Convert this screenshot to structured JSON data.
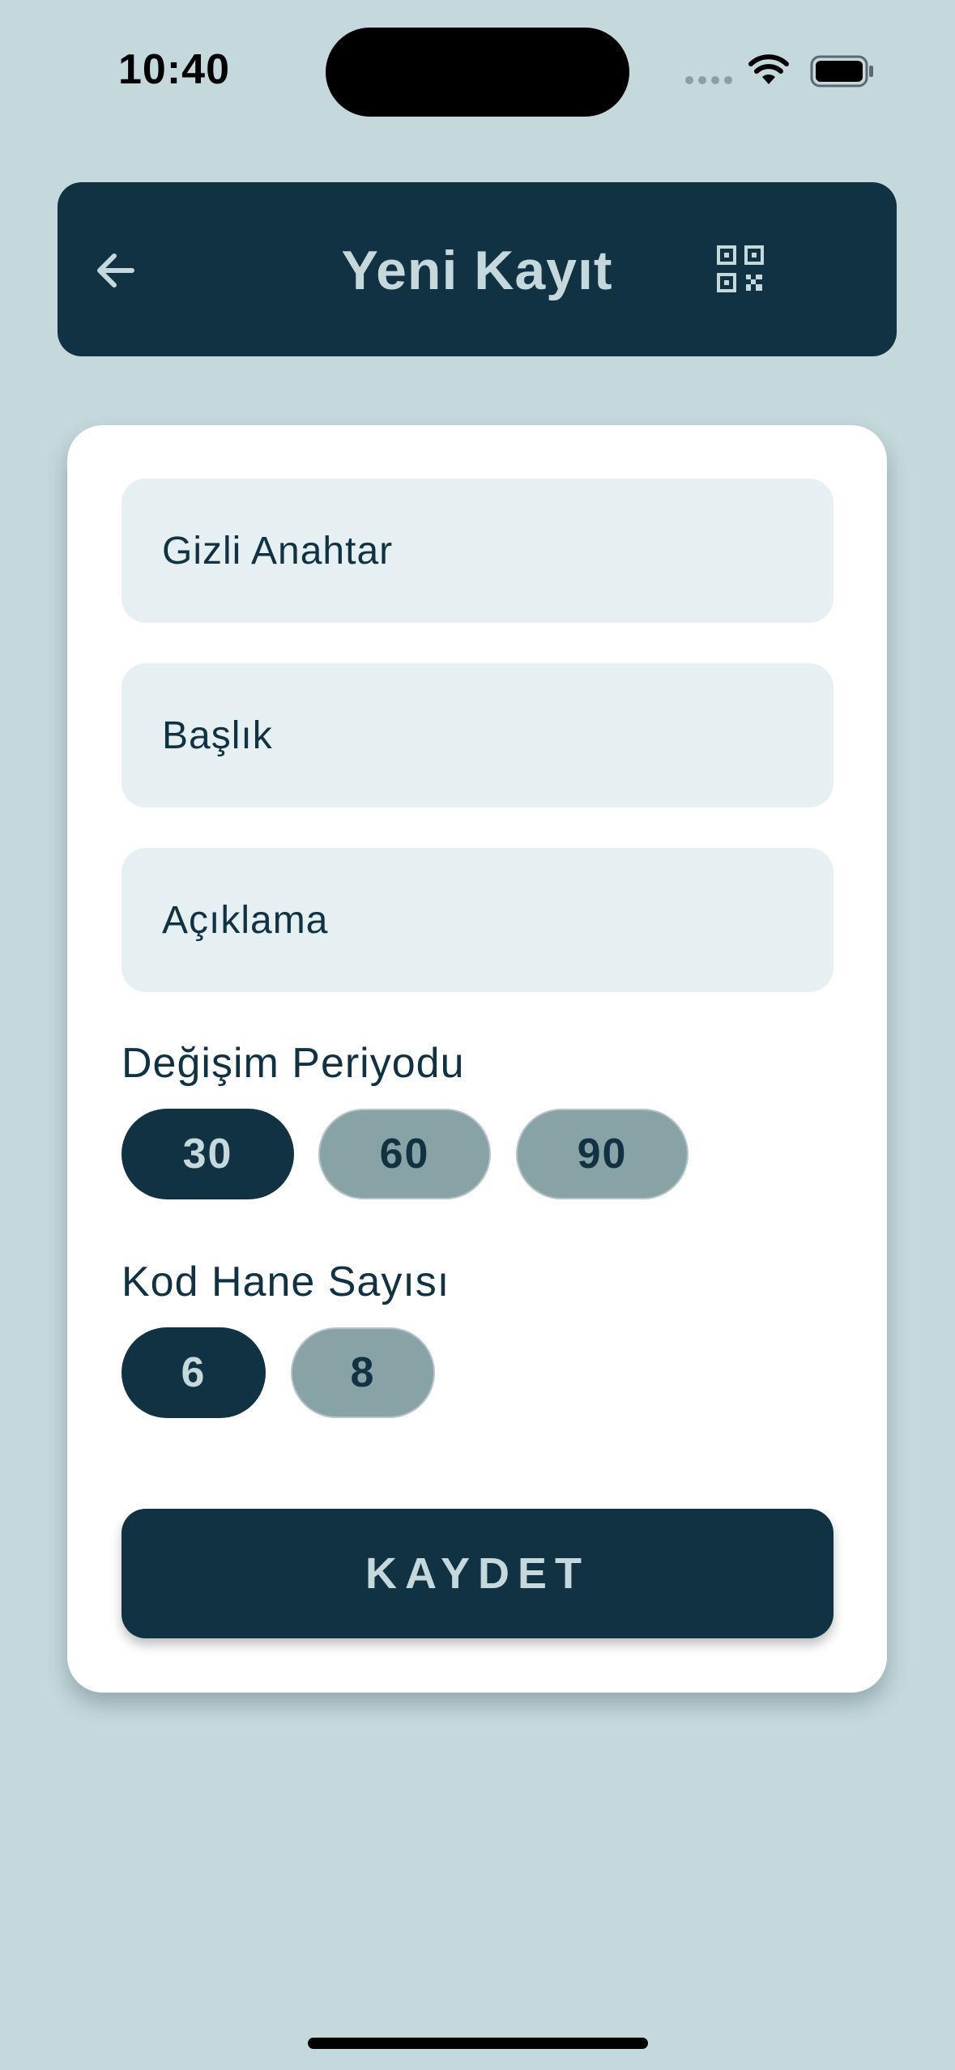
{
  "status_bar": {
    "time": "10:40",
    "icons": [
      "cellular-signal-icon",
      "wifi-icon",
      "battery-icon"
    ]
  },
  "header": {
    "title": "Yeni Kayıt",
    "back_icon": "arrow-left-icon",
    "scan_icon": "qr-code-scan-icon"
  },
  "form": {
    "secret_key_placeholder": "Gizli Anahtar",
    "title_placeholder": "Başlık",
    "description_placeholder": "Açıklama",
    "period": {
      "label": "Değişim Periyodu",
      "options": [
        "30",
        "60",
        "90"
      ],
      "selected": "30"
    },
    "digits": {
      "label": "Kod Hane Sayısı",
      "options": [
        "6",
        "8"
      ],
      "selected": "6"
    },
    "save_label": "KAYDET"
  },
  "colors": {
    "background": "#c5d8dc",
    "primary": "#113242",
    "field_background": "#e6eff1",
    "chip_unselected": "#87a3a6",
    "card": "#ffffff"
  }
}
